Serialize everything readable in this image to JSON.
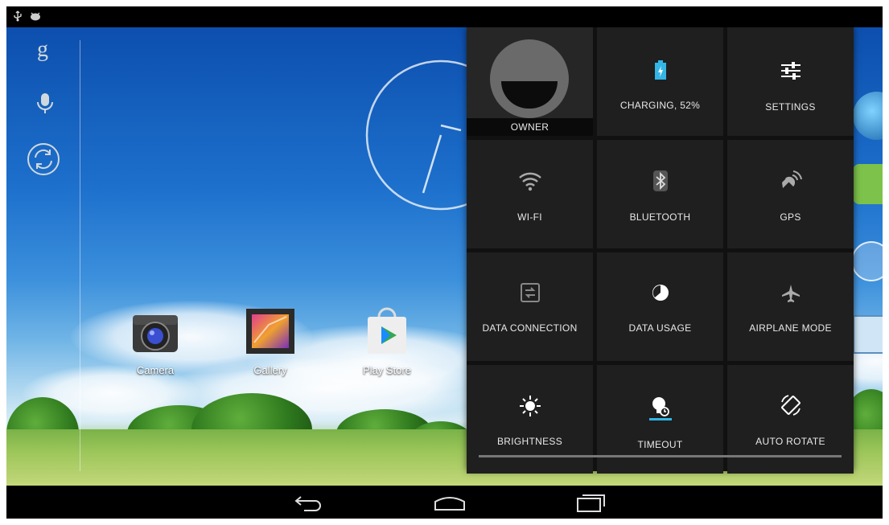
{
  "status_bar": {
    "icons": [
      "usb-icon",
      "android-debug-icon"
    ]
  },
  "home": {
    "side_icons": [
      "google-search-icon",
      "voice-search-icon",
      "sync-icon"
    ],
    "apps": [
      {
        "label": "Camera",
        "icon": "camera-icon"
      },
      {
        "label": "Gallery",
        "icon": "gallery-icon"
      },
      {
        "label": "Play Store",
        "icon": "play-store-icon"
      }
    ]
  },
  "quick_settings": {
    "owner": {
      "label": "OWNER",
      "icon": "avatar-icon"
    },
    "tiles": [
      {
        "label": "CHARGING, 52%",
        "icon": "battery-charging-icon",
        "accent": "#33b5e5"
      },
      {
        "label": "SETTINGS",
        "icon": "settings-sliders-icon"
      },
      {
        "label": "WI-FI",
        "icon": "wifi-icon"
      },
      {
        "label": "BLUETOOTH",
        "icon": "bluetooth-icon"
      },
      {
        "label": "GPS",
        "icon": "gps-icon"
      },
      {
        "label": "DATA CONNECTION",
        "icon": "data-connection-icon"
      },
      {
        "label": "DATA USAGE",
        "icon": "data-usage-icon"
      },
      {
        "label": "AIRPLANE MODE",
        "icon": "airplane-icon"
      },
      {
        "label": "BRIGHTNESS",
        "icon": "brightness-icon"
      },
      {
        "label": "TIMEOUT",
        "icon": "timeout-icon",
        "accent": "#33b5e5"
      },
      {
        "label": "AUTO ROTATE",
        "icon": "auto-rotate-icon"
      }
    ]
  },
  "nav_bar": {
    "buttons": [
      "back-icon",
      "home-icon",
      "recent-apps-icon"
    ]
  },
  "colors": {
    "accent": "#33b5e5",
    "tile_bg": "#1f1f1f",
    "panel_bg": "#111111"
  }
}
